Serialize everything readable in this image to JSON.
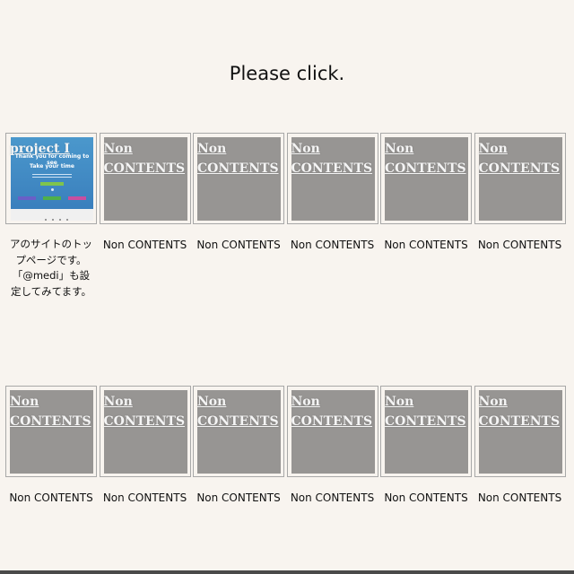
{
  "heading": "Please click.",
  "project_tile": {
    "label": "project I",
    "thumb_line1": "Thank you for coming to see",
    "thumb_line2": "Take your time",
    "caption": "アのサイトのトップページです。「@medi」も設定してみてます。"
  },
  "placeholder": {
    "tile_label": "Non CONTENTS",
    "caption": "Non CONTENTS"
  },
  "row1": [
    {
      "tile_label": "Non CONTENTS",
      "caption": "Non CONTENTS"
    },
    {
      "tile_label": "Non CONTENTS",
      "caption": "Non CONTENTS"
    },
    {
      "tile_label": "Non CONTENTS",
      "caption": "Non CONTENTS"
    },
    {
      "tile_label": "Non CONTENTS",
      "caption": "Non CONTENTS"
    },
    {
      "tile_label": "Non CONTENTS",
      "caption": "Non CONTENTS"
    }
  ],
  "row2": [
    {
      "tile_label": "Non CONTENTS",
      "caption": "Non CONTENTS"
    },
    {
      "tile_label": "Non CONTENTS",
      "caption": "Non CONTENTS"
    },
    {
      "tile_label": "Non CONTENTS",
      "caption": "Non CONTENTS"
    },
    {
      "tile_label": "Non CONTENTS",
      "caption": "Non CONTENTS"
    },
    {
      "tile_label": "Non CONTENTS",
      "caption": "Non CONTENTS"
    },
    {
      "tile_label": "Non CONTENTS",
      "caption": "Non CONTENTS"
    }
  ],
  "colors": {
    "background": "#f8f4ef",
    "tile_gray": "#979593",
    "tile_border": "#a8a8a8",
    "thumb_blue": "#3a7fbd"
  }
}
